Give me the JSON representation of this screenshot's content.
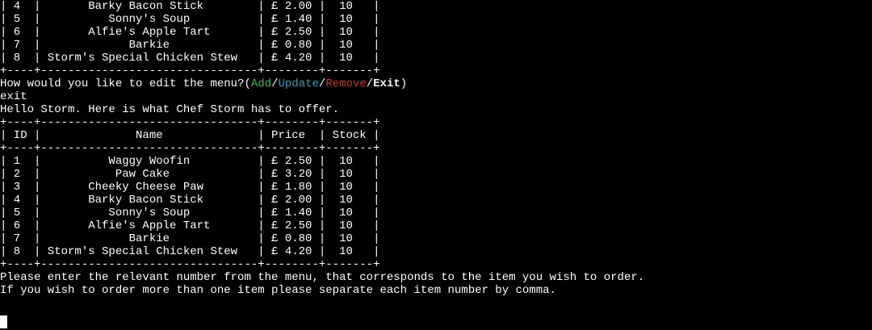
{
  "terminal": {
    "lines_top": [
      "| 4  |       Barky Bacon Stick        | £ 2.00 |  10   |",
      "| 5  |          Sonny's Soup          | £ 1.40 |  10   |",
      "| 6  |       Alfie's Apple Tart       | £ 2.50 |  10   |",
      "| 7  |             Barkie             | £ 0.80 |  10   |",
      "| 8  | Storm's Special Chicken Stew   | £ 4.20 |  10   |",
      "+----+--------------------------------+--------+-------+"
    ],
    "prompt": {
      "prefix": "How would you like to edit the menu?(",
      "add": "Add",
      "sep1": "/",
      "update": "Update",
      "sep2": "/",
      "remove": "Remove",
      "sep3": "/",
      "exit": "Exit",
      "suffix": ")"
    },
    "input_echo": "exit",
    "greeting": "Hello Storm. Here is what Chef Storm has to offer.",
    "table": [
      "+----+--------------------------------+--------+-------+",
      "| ID |              Name              | Price  | Stock |",
      "+----+--------------------------------+--------+-------+",
      "| 1  |          Waggy Woofin          | £ 2.50 |  10   |",
      "| 2  |           Paw Cake             | £ 3.20 |  10   |",
      "| 3  |       Cheeky Cheese Paw        | £ 1.80 |  10   |",
      "| 4  |       Barky Bacon Stick        | £ 2.00 |  10   |",
      "| 5  |          Sonny's Soup          | £ 1.40 |  10   |",
      "| 6  |       Alfie's Apple Tart       | £ 2.50 |  10   |",
      "| 7  |             Barkie             | £ 0.80 |  10   |",
      "| 8  | Storm's Special Chicken Stew   | £ 4.20 |  10   |",
      "+----+--------------------------------+--------+-------+"
    ],
    "instructions": [
      "Please enter the relevant number from the menu, that corresponds to the item you wish to order.",
      "If you wish to order more than one item please separate each item number by comma."
    ]
  }
}
